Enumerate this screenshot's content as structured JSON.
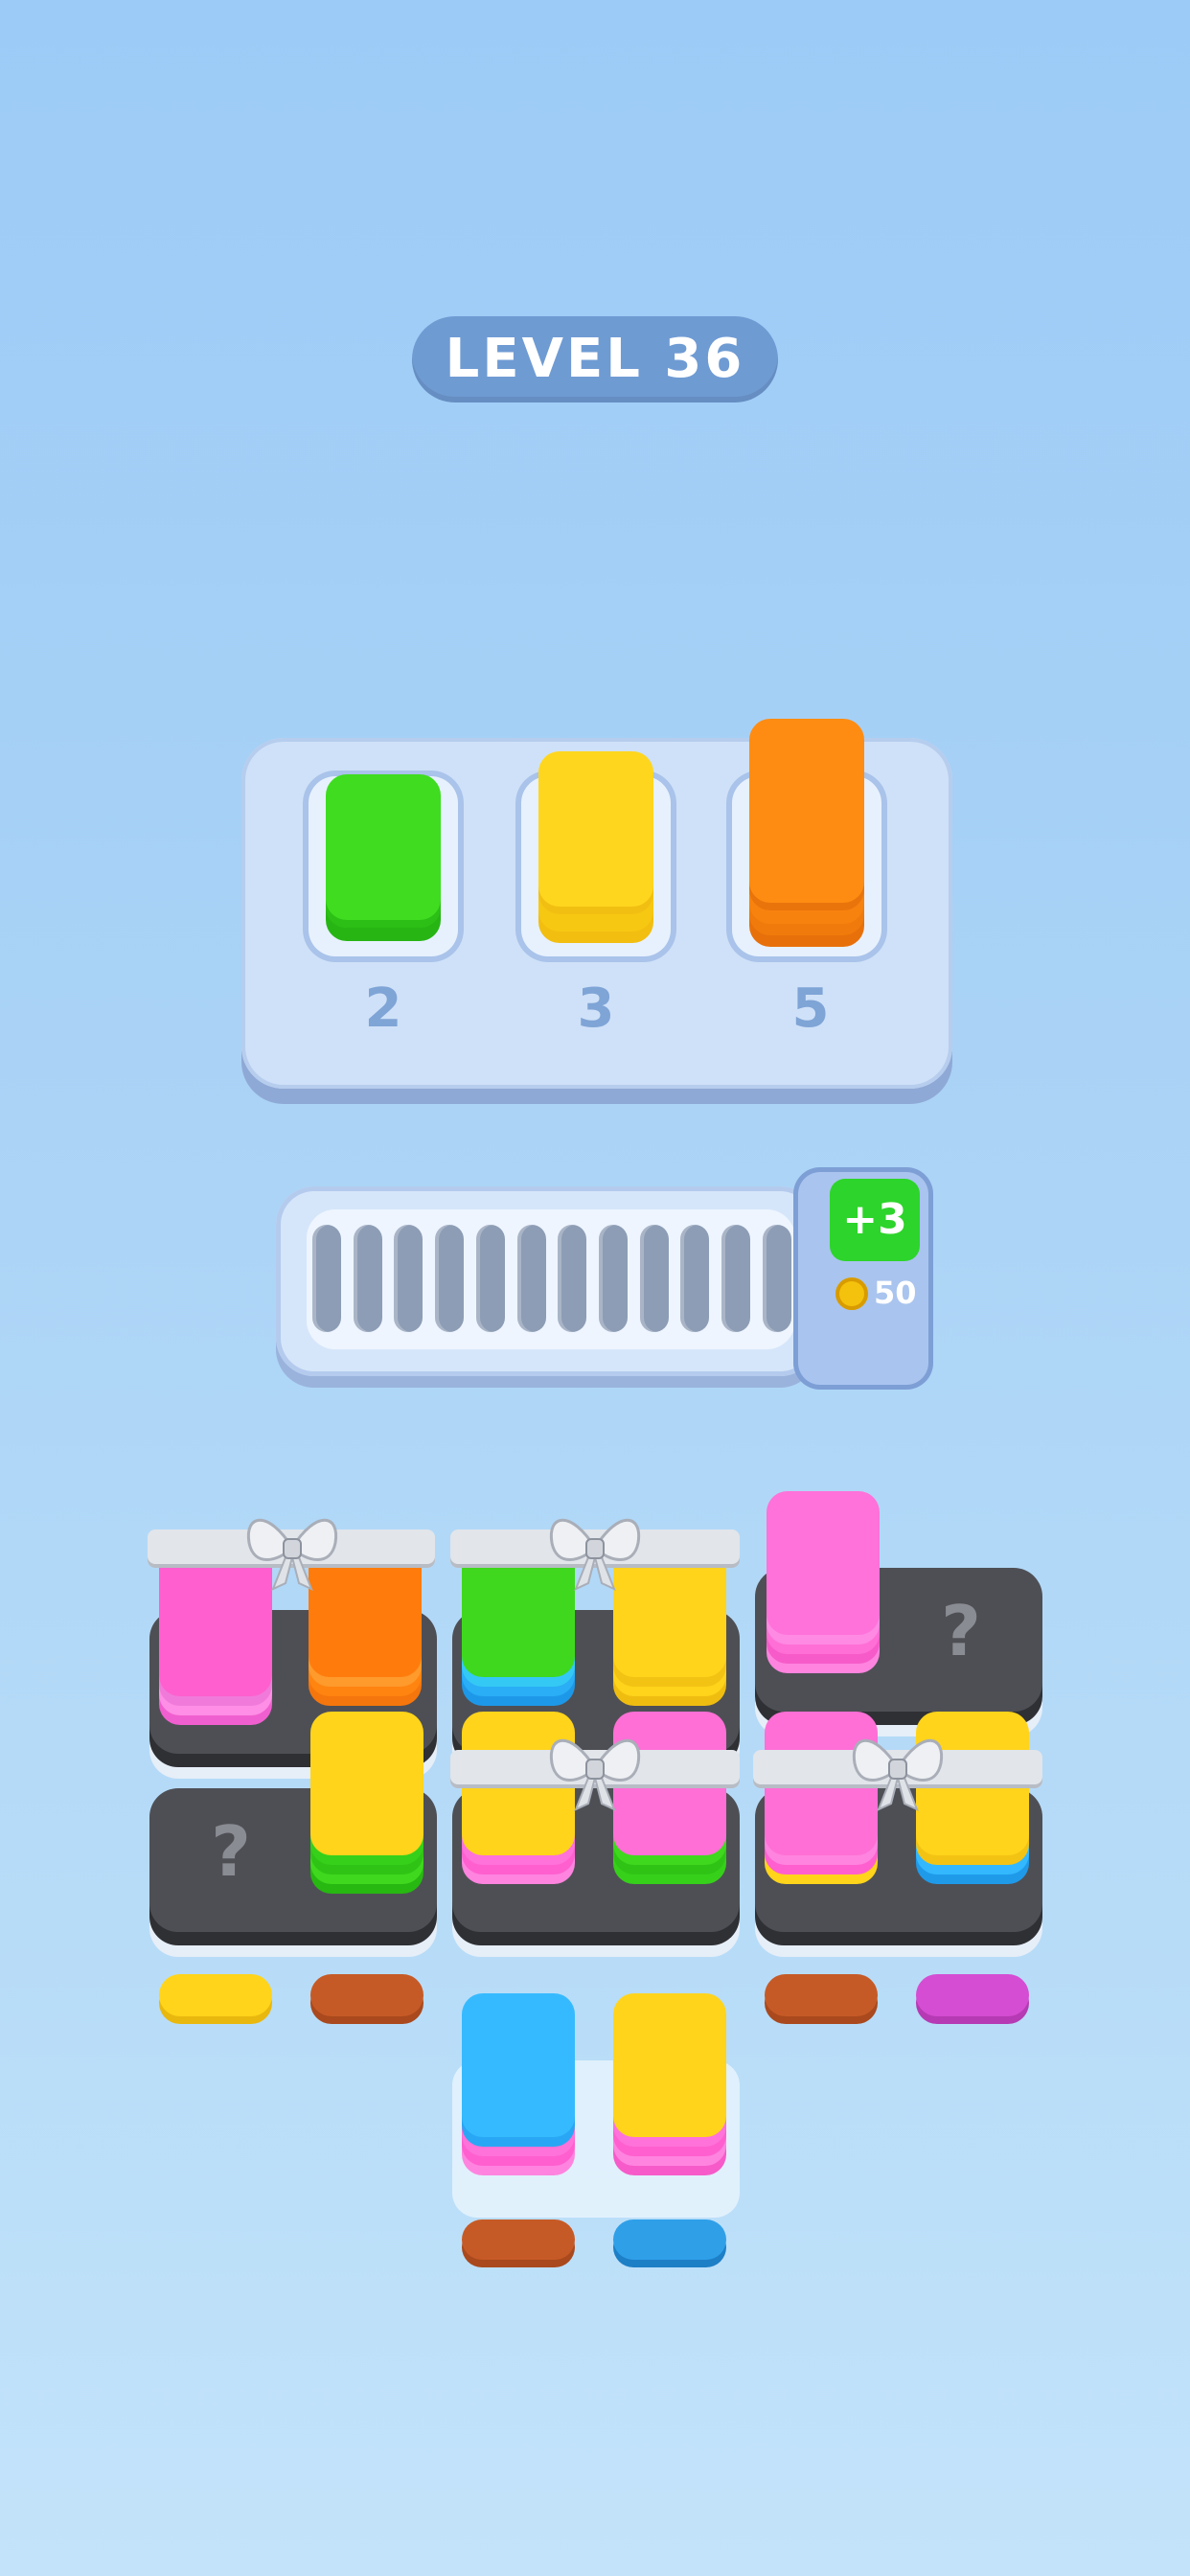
{
  "level": {
    "label": "LEVEL 36"
  },
  "targets": [
    {
      "count": "2",
      "color": "#39d81d",
      "icon": "green-tile-stack-icon"
    },
    {
      "count": "3",
      "color": "#ffd21c",
      "icon": "yellow-tile-stack-icon"
    },
    {
      "count": "5",
      "color": "#ff8a0c",
      "icon": "orange-tile-stack-icon"
    }
  ],
  "holding_rail": {
    "empty_slots": 12
  },
  "buy_slots": {
    "label": "+3",
    "price": "50",
    "icon": "coin-icon"
  },
  "board": {
    "locked_label": "?",
    "colors": {
      "pink": "#ff6fd6",
      "orange": "#ff8410",
      "green": "#38d61b",
      "yellow": "#ffd51c",
      "blue": "#33b8ff",
      "brown": "#c0562a",
      "magenta": "#d54dd2"
    }
  }
}
